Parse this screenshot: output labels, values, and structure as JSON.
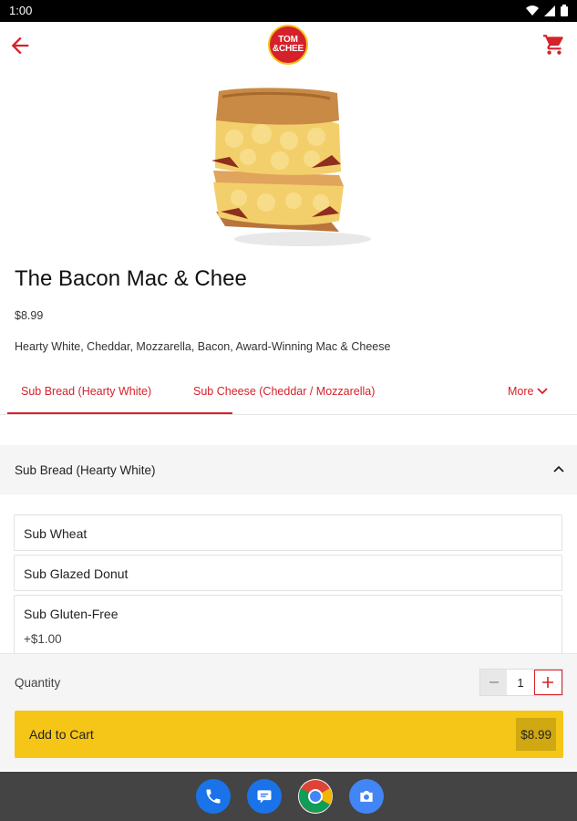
{
  "status_bar": {
    "time": "1:00"
  },
  "header": {
    "logo_line1": "TOM",
    "logo_line2": "&CHEE"
  },
  "product": {
    "title": "The Bacon Mac & Chee",
    "price": "$8.99",
    "description": "Hearty White, Cheddar, Mozzarella, Bacon, Award-Winning Mac & Cheese"
  },
  "tabs": {
    "items": [
      "Sub Bread (Hearty White)",
      "Sub Cheese (Cheddar / Mozzarella)"
    ],
    "more_label": "More"
  },
  "section": {
    "title": "Sub Bread (Hearty White)",
    "options": [
      {
        "name": "Sub Wheat",
        "extra": ""
      },
      {
        "name": "Sub Glazed Donut",
        "extra": ""
      },
      {
        "name": "Sub Gluten-Free",
        "extra": "+$1.00"
      }
    ]
  },
  "footer": {
    "quantity_label": "Quantity",
    "quantity_value": "1",
    "add_to_cart_label": "Add to Cart",
    "total": "$8.99"
  },
  "colors": {
    "accent_red": "#d6212a",
    "cart_yellow": "#f5c518"
  }
}
